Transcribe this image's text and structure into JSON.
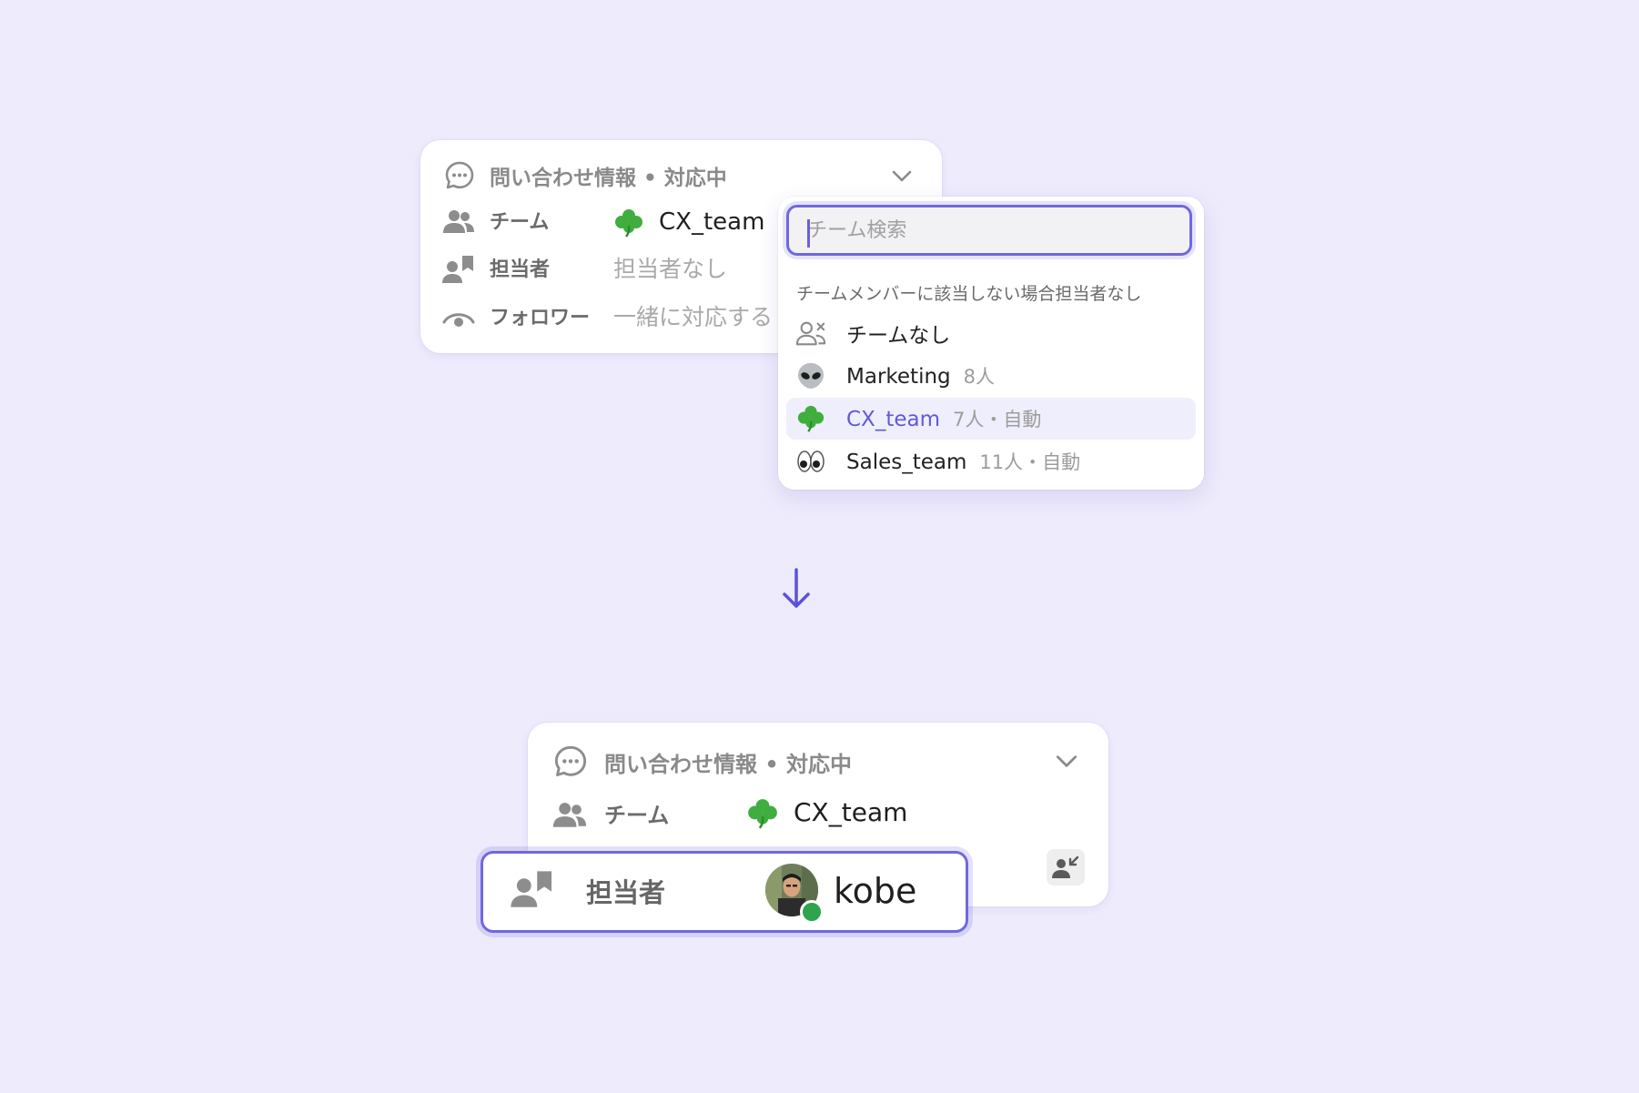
{
  "top_card": {
    "header": "問い合わせ情報 • 対応中",
    "team_label": "チーム",
    "team_value": "CX_team",
    "assignee_label": "担当者",
    "assignee_value": "担当者なし",
    "follower_label": "フォロワー",
    "follower_value": "一緒に対応する"
  },
  "dropdown": {
    "search_placeholder": "チーム検索",
    "hint": "チームメンバーに該当しない場合担当者なし",
    "options": [
      {
        "name": "チームなし",
        "meta": "",
        "icon": "no-team-icon",
        "selected": false
      },
      {
        "name": "Marketing",
        "meta": "8人",
        "icon": "alien-emoji",
        "selected": false
      },
      {
        "name": "CX_team",
        "meta": "7人・自動",
        "icon": "clover-emoji",
        "selected": true
      },
      {
        "name": "Sales_team",
        "meta": "11人・自動",
        "icon": "eyes-emoji",
        "selected": false
      }
    ]
  },
  "bottom_card": {
    "header": "問い合わせ情報 • 対応中",
    "team_label": "チーム",
    "team_value": "CX_team",
    "assignee_label": "担当者",
    "assignee_value": "kobe",
    "presence": "online"
  },
  "colors": {
    "background": "#eeebfd",
    "accent": "#7068e0",
    "selected_text": "#6259d8",
    "online": "#2ea44f"
  }
}
